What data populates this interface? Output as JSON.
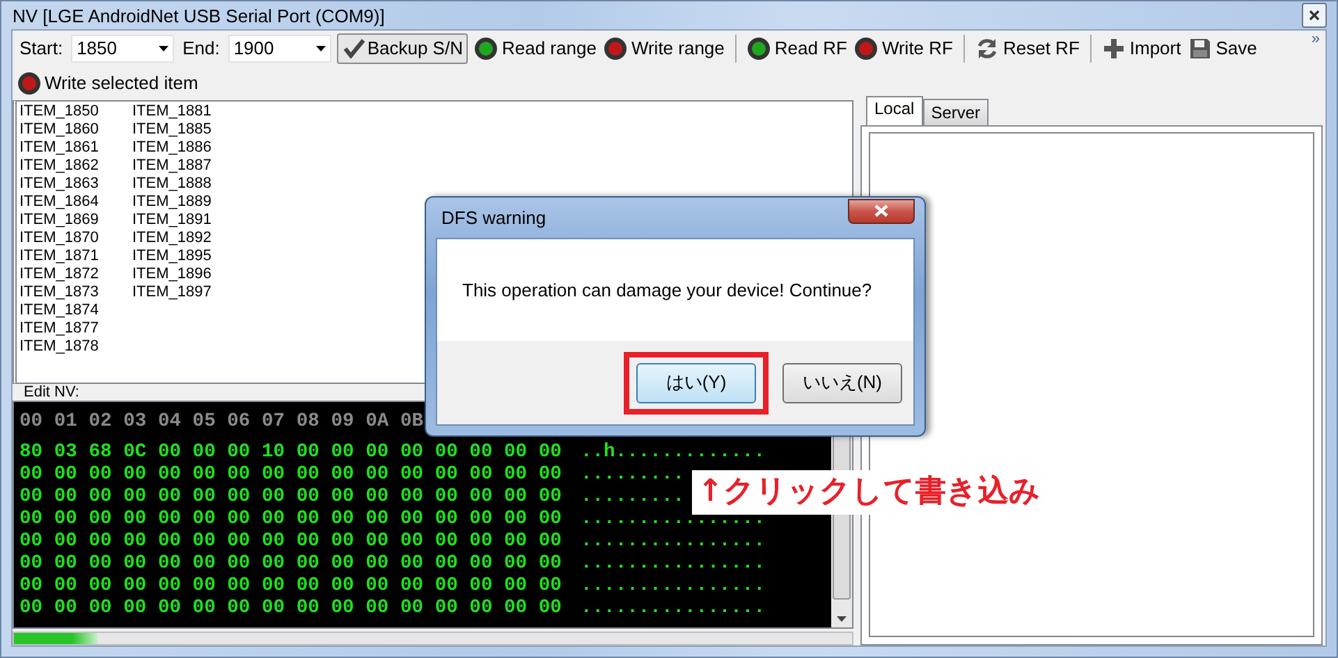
{
  "window": {
    "title": "NV  [LGE AndroidNet USB Serial Port (COM9)]"
  },
  "toolbar": {
    "items": [
      {
        "kind": "combo",
        "label": "Start:",
        "value": "1850"
      },
      {
        "kind": "combo",
        "label": "End:",
        "value": "1900"
      },
      {
        "kind": "toggle",
        "label": "Backup S/N",
        "checked": true
      },
      {
        "kind": "led",
        "label": "Read range",
        "color": "#1fa81f"
      },
      {
        "kind": "led",
        "label": "Write range",
        "color": "#c01818"
      },
      {
        "kind": "separator"
      },
      {
        "kind": "led",
        "label": "Read RF",
        "color": "#1fa81f"
      },
      {
        "kind": "led",
        "label": "Write RF",
        "color": "#c01818"
      },
      {
        "kind": "separator"
      },
      {
        "kind": "refresh",
        "label": "Reset RF"
      },
      {
        "kind": "separator"
      },
      {
        "kind": "add",
        "label": "Import"
      },
      {
        "kind": "disk",
        "label": "Save"
      }
    ],
    "overflow": "»"
  },
  "second_row": {
    "items": [
      {
        "kind": "led",
        "label": "Write selected item",
        "color": "#c01818"
      }
    ]
  },
  "item_list": {
    "columns": [
      [
        "ITEM_1850",
        "ITEM_1860",
        "ITEM_1861",
        "ITEM_1862",
        "ITEM_1863",
        "ITEM_1864",
        "ITEM_1869",
        "ITEM_1870",
        "ITEM_1871",
        "ITEM_1872",
        "ITEM_1873",
        "ITEM_1874",
        "ITEM_1877",
        "ITEM_1878"
      ],
      [
        "ITEM_1881",
        "ITEM_1885",
        "ITEM_1886",
        "ITEM_1887",
        "ITEM_1888",
        "ITEM_1889",
        "ITEM_1891",
        "ITEM_1892",
        "ITEM_1895",
        "ITEM_1896",
        "ITEM_1897"
      ]
    ]
  },
  "editor": {
    "label": "Edit NV:",
    "header": [
      "00",
      "01",
      "02",
      "03",
      "04",
      "05",
      "06",
      "07",
      "08",
      "09",
      "0A",
      "0B"
    ],
    "rows": [
      {
        "hex": [
          "80",
          "03",
          "68",
          "0C",
          "00",
          "00",
          "00",
          "10",
          "00",
          "00",
          "00",
          "00",
          "00",
          "00",
          "00",
          "00"
        ],
        "ascii": "..h............."
      },
      {
        "hex": [
          "00",
          "00",
          "00",
          "00",
          "00",
          "00",
          "00",
          "00",
          "00",
          "00",
          "00",
          "00",
          "00",
          "00",
          "00",
          "00"
        ],
        "ascii": "........."
      },
      {
        "hex": [
          "00",
          "00",
          "00",
          "00",
          "00",
          "00",
          "00",
          "00",
          "00",
          "00",
          "00",
          "00",
          "00",
          "00",
          "00",
          "00"
        ],
        "ascii": "........."
      },
      {
        "hex": [
          "00",
          "00",
          "00",
          "00",
          "00",
          "00",
          "00",
          "00",
          "00",
          "00",
          "00",
          "00",
          "00",
          "00",
          "00",
          "00"
        ],
        "ascii": "................"
      },
      {
        "hex": [
          "00",
          "00",
          "00",
          "00",
          "00",
          "00",
          "00",
          "00",
          "00",
          "00",
          "00",
          "00",
          "00",
          "00",
          "00",
          "00"
        ],
        "ascii": "................"
      },
      {
        "hex": [
          "00",
          "00",
          "00",
          "00",
          "00",
          "00",
          "00",
          "00",
          "00",
          "00",
          "00",
          "00",
          "00",
          "00",
          "00",
          "00"
        ],
        "ascii": "................"
      },
      {
        "hex": [
          "00",
          "00",
          "00",
          "00",
          "00",
          "00",
          "00",
          "00",
          "00",
          "00",
          "00",
          "00",
          "00",
          "00",
          "00",
          "00"
        ],
        "ascii": "................"
      },
      {
        "hex": [
          "00",
          "00",
          "00",
          "00",
          "00",
          "00",
          "00",
          "00",
          "00",
          "00",
          "00",
          "00",
          "00",
          "00",
          "00",
          "00"
        ],
        "ascii": "................"
      }
    ],
    "progress": {
      "level": 0.1
    }
  },
  "side_panel": {
    "tabs": [
      {
        "label": "Local",
        "selected": true
      },
      {
        "label": "Server",
        "selected": false
      }
    ]
  },
  "dialog": {
    "title": "DFS warning",
    "message": "This operation can damage your device! Continue?",
    "buttons": [
      {
        "label": "はい(Y)",
        "default": true,
        "highlighted": true
      },
      {
        "label": "いいえ(N)",
        "default": false,
        "highlighted": false
      }
    ]
  },
  "annotation": {
    "text": "↑クリックして書き込み"
  }
}
